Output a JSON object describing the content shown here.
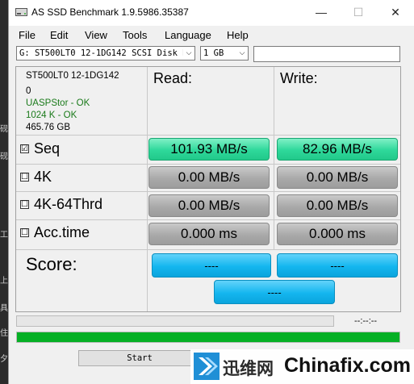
{
  "window": {
    "title": "AS SSD Benchmark 1.9.5986.35387",
    "minimize_glyph": "—",
    "maximize_glyph": "☐",
    "close_glyph": "✕"
  },
  "menu": [
    "File",
    "Edit",
    "View",
    "Tools",
    "Language",
    "Help"
  ],
  "toolbar": {
    "drive_select": "G: ST500LT0 12-1DG142 SCSI Disk D",
    "size_select": "1 GB",
    "dropdown_glyph": "⌵"
  },
  "drive_info": {
    "model_line1": "ST500LT0 12-1DG142",
    "model_line2": "0",
    "driver": "UASPStor - OK",
    "alignment": "1024 K - OK",
    "capacity": "465.76 GB"
  },
  "columns": {
    "read": "Read:",
    "write": "Write:"
  },
  "rows": [
    {
      "label": "Seq",
      "checked": true,
      "check_glyph": "☑",
      "read": "101.93 MB/s",
      "write": "82.96 MB/s"
    },
    {
      "label": "4K",
      "checked": false,
      "check_glyph": "☐",
      "read": "0.00 MB/s",
      "write": "0.00 MB/s"
    },
    {
      "label": "4K-64Thrd",
      "checked": false,
      "check_glyph": "☐",
      "read": "0.00 MB/s",
      "write": "0.00 MB/s"
    },
    {
      "label": "Acc.time",
      "checked": false,
      "check_glyph": "☐",
      "read": "0.000 ms",
      "write": "0.000 ms"
    }
  ],
  "score": {
    "label": "Score:",
    "read": "----",
    "write": "----",
    "total": "----"
  },
  "progress": {
    "timer": "--:--:--",
    "main_fraction": 1.0
  },
  "start_label": "Start",
  "watermark": {
    "cn": "迅维网",
    "en": "Chinafix.com"
  },
  "side_fragments": [
    "砚",
    "砚",
    "工",
    "上",
    "具",
    "住",
    "夕"
  ],
  "colors": {
    "green_result": "#2ed89a",
    "gray_result": "#a9a9a9",
    "score_blue": "#14b6ef",
    "progress_green": "#06b025",
    "info_green": "#1a7a1a"
  }
}
